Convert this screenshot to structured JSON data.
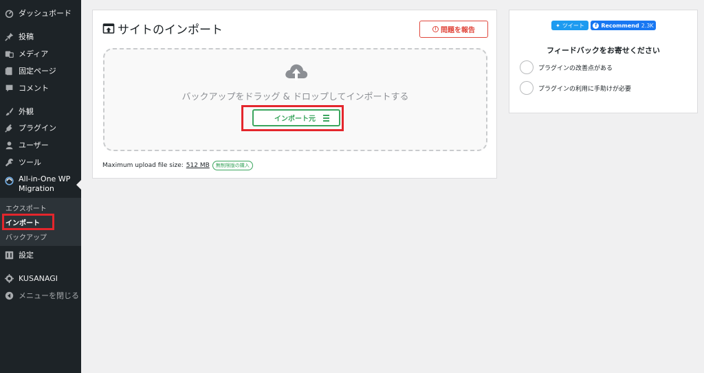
{
  "sidebar": {
    "items": [
      {
        "label": "ダッシュボード",
        "icon": "dashboard-icon"
      },
      {
        "label": "投稿",
        "icon": "pin-icon"
      },
      {
        "label": "メディア",
        "icon": "media-icon"
      },
      {
        "label": "固定ページ",
        "icon": "page-icon"
      },
      {
        "label": "コメント",
        "icon": "comment-icon"
      },
      {
        "label": "外観",
        "icon": "brush-icon"
      },
      {
        "label": "プラグイン",
        "icon": "plugin-icon"
      },
      {
        "label": "ユーザー",
        "icon": "user-icon"
      },
      {
        "label": "ツール",
        "icon": "wrench-icon"
      },
      {
        "label": "All-in-One WP Migration",
        "icon": "aio-icon"
      },
      {
        "label": "設定",
        "icon": "settings-icon"
      },
      {
        "label": "KUSANAGI",
        "icon": "gear-icon"
      },
      {
        "label": "メニューを閉じる",
        "icon": "collapse-icon"
      }
    ],
    "aio_line1": "All-in-One WP",
    "aio_line2": "Migration",
    "submenu": {
      "export": "エクスポート",
      "import": "インポート",
      "backup": "バックアップ"
    }
  },
  "main": {
    "title": "サイトのインポート",
    "report_button": "問題を報告",
    "drop_text": "バックアップをドラッグ & ドロップしてインポートする",
    "import_button": "インポート元",
    "upload_label": "Maximum upload file size:",
    "upload_size": "512 MB",
    "unlimited_badge": "無制限版の購入"
  },
  "feedback": {
    "tweet": "ツイート",
    "recommend": "Recommend",
    "recommend_count": "2.3K",
    "title": "フィードバックをお寄せください",
    "options": [
      "プラグインの改善点がある",
      "プラグインの利用に手助けが必要"
    ]
  },
  "colors": {
    "sidebar_bg": "#1d2327",
    "accent_green": "#3aa55d",
    "accent_red": "#e0463b",
    "highlight_red": "#e4262c"
  }
}
